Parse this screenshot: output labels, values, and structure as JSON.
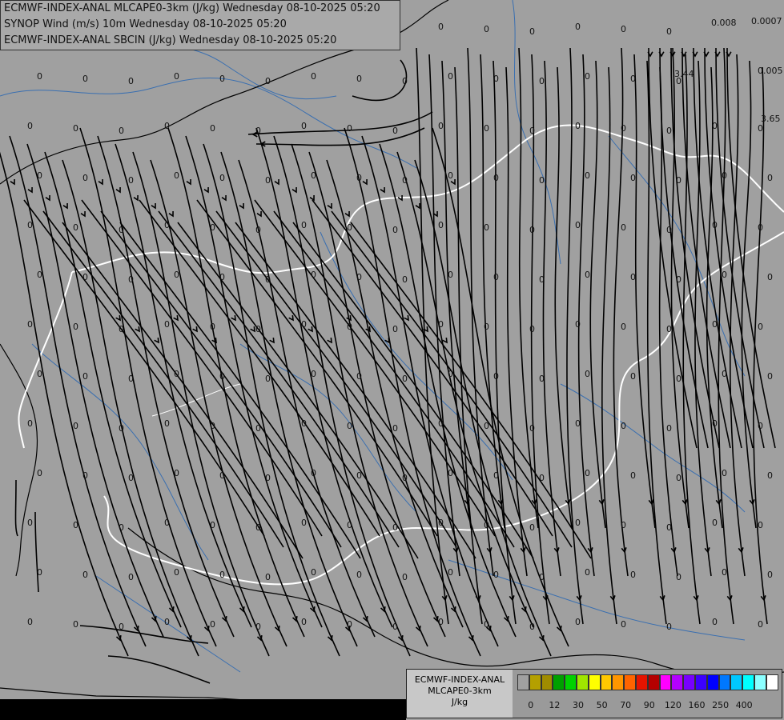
{
  "titles": {
    "line1": "ECMWF-INDEX-ANAL MLCAPE0-3km (J/kg) Wednesday 08-10-2025 05:20",
    "line2": "SYNOP Wind (m/s) 10m Wednesday 08-10-2025 05:20",
    "line3": "ECMWF-INDEX-ANAL SBCIN (J/kg) Wednesday 08-10-2025 05:20"
  },
  "legend": {
    "model": "ECMWF-INDEX-ANAL",
    "param": "MLCAPE0-3km",
    "unit": "J/kg",
    "colors": [
      "#a0a0a0",
      "#b4a000",
      "#a08c00",
      "#00a000",
      "#00d200",
      "#a0e600",
      "#ffff00",
      "#ffc800",
      "#ff9600",
      "#ff6400",
      "#e61400",
      "#b40000",
      "#ff00ff",
      "#b400ff",
      "#7800ff",
      "#3c00ff",
      "#0000ff",
      "#0078ff",
      "#00c8ff",
      "#00ffff",
      "#8cffff",
      "#ffffff"
    ],
    "ticks": [
      {
        "label": "0",
        "index": 1
      },
      {
        "label": "12",
        "index": 3
      },
      {
        "label": "30",
        "index": 5
      },
      {
        "label": "50",
        "index": 7
      },
      {
        "label": "70",
        "index": 9
      },
      {
        "label": "90",
        "index": 11
      },
      {
        "label": "120",
        "index": 13
      },
      {
        "label": "160",
        "index": 15
      },
      {
        "label": "250",
        "index": 17
      },
      {
        "label": "400",
        "index": 19
      }
    ]
  },
  "corner_values": [
    "0.008",
    "0.0007",
    "0.005",
    "3.44",
    "3.65"
  ],
  "field_value": "0"
}
